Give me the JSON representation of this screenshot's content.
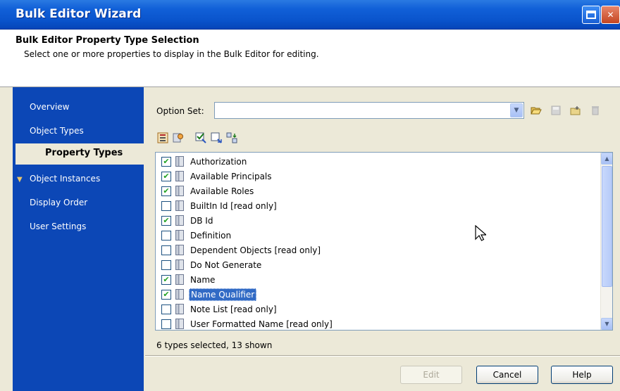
{
  "window": {
    "title": "Bulk Editor Wizard"
  },
  "header": {
    "title": "Bulk Editor Property Type Selection",
    "subtitle": "Select one or more properties to display in the Bulk Editor for editing."
  },
  "sidebar": {
    "items": [
      {
        "label": "Overview",
        "active": false
      },
      {
        "label": "Object Types",
        "active": false
      },
      {
        "label": "Property Types",
        "active": true
      },
      {
        "label": "Object Instances",
        "active": false,
        "marker": "arrow-icon"
      },
      {
        "label": "Display Order",
        "active": false
      },
      {
        "label": "User Settings",
        "active": false
      }
    ]
  },
  "option_set": {
    "label": "Option Set:",
    "value": ""
  },
  "properties": [
    {
      "label": "Authorization",
      "checked": true
    },
    {
      "label": "Available Principals",
      "checked": true
    },
    {
      "label": "Available Roles",
      "checked": true
    },
    {
      "label": "BuiltIn Id [read only]",
      "checked": false
    },
    {
      "label": "DB Id",
      "checked": true
    },
    {
      "label": "Definition",
      "checked": false
    },
    {
      "label": "Dependent Objects [read only]",
      "checked": false
    },
    {
      "label": "Do Not Generate",
      "checked": false
    },
    {
      "label": "Name",
      "checked": true
    },
    {
      "label": "Name Qualifier",
      "checked": true,
      "selected": true
    },
    {
      "label": "Note List [read only]",
      "checked": false
    },
    {
      "label": "User Formatted Name [read only]",
      "checked": false
    }
  ],
  "status": "6 types selected, 13 shown",
  "buttons": {
    "edit": "Edit",
    "cancel": "Cancel",
    "help": "Help"
  },
  "colors": {
    "titlebar": "#0a54cc",
    "sidebar": "#0c47b6",
    "selection": "#316ac5",
    "dialog_bg": "#ece9d8"
  }
}
